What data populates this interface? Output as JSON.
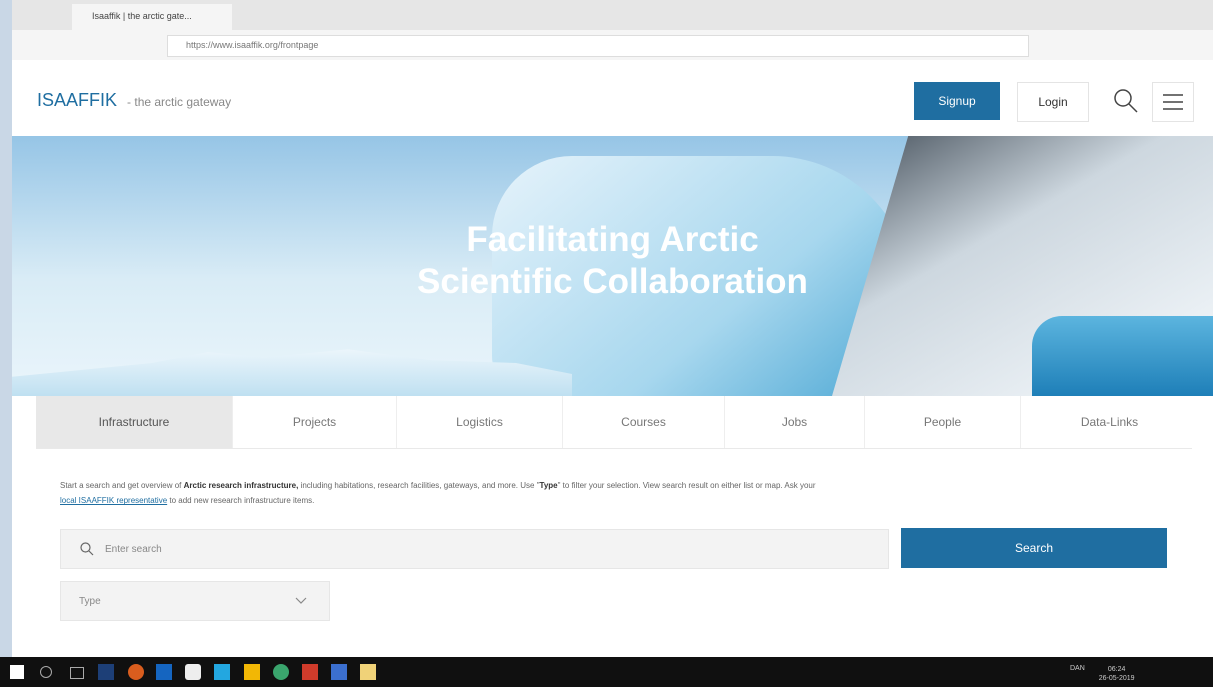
{
  "browser": {
    "tab_title": "Isaaffik | the arctic gate...",
    "url_text": "https://www.isaaffik.org/frontpage"
  },
  "site": {
    "logo": "ISAAFFIK",
    "tagline": "- the arctic gateway",
    "signup": "Signup",
    "login": "Login"
  },
  "hero": {
    "line1": "Facilitating Arctic",
    "line2": "Scientific Collaboration"
  },
  "tabs": [
    {
      "label": "Infrastructure"
    },
    {
      "label": "Projects"
    },
    {
      "label": "Logistics"
    },
    {
      "label": "Courses"
    },
    {
      "label": "Jobs"
    },
    {
      "label": "People"
    },
    {
      "label": "Data-Links"
    }
  ],
  "description": {
    "part1": "Start a search and get overview of ",
    "bold1": "Arctic research infrastructure,",
    "part2": " including habitations, research facilities, gateways, and more. Use \"",
    "bold2": "Type",
    "part3": "\" to filter your selection. View search result on either list or map. Ask your",
    "link": "local ISAAFFIK representative",
    "part4": " to add new research infrastructure items."
  },
  "search": {
    "placeholder": "Enter search",
    "button": "Search",
    "type_label": "Type"
  },
  "taskbar": {
    "lang": "DAN",
    "time": "06:24",
    "date": "26-05-2019"
  },
  "colors": {
    "accent": "#1f6ea1",
    "taskbar": "#101010"
  }
}
